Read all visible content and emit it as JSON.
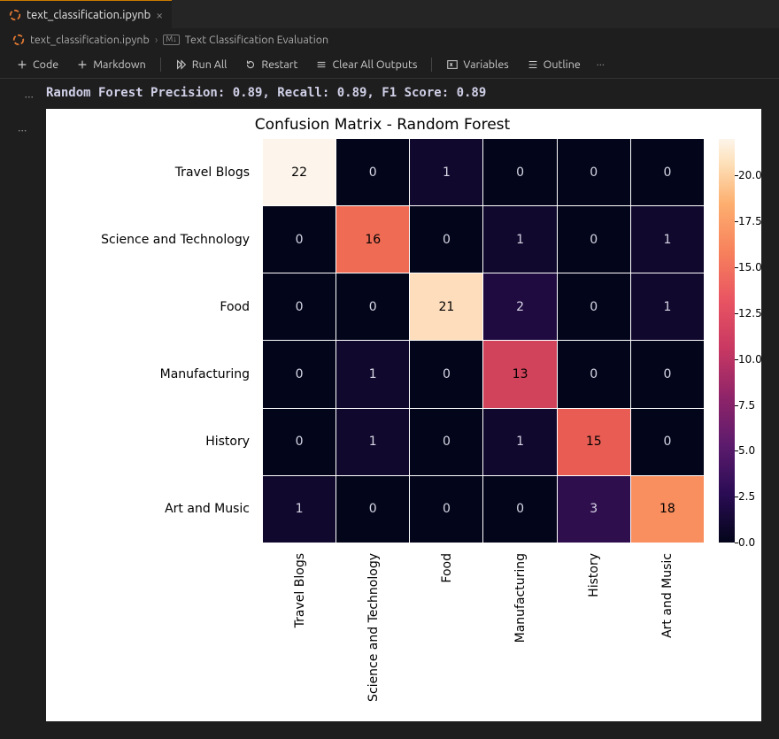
{
  "tab": {
    "filename": "text_classification.ipynb"
  },
  "breadcrumbs": {
    "file": "text_classification.ipynb",
    "cell": "Text Classification Evaluation"
  },
  "toolbar": {
    "code": "Code",
    "markdown": "Markdown",
    "run_all": "Run All",
    "restart": "Restart",
    "clear": "Clear All Outputs",
    "variables": "Variables",
    "outline": "Outline"
  },
  "output_text": "Random Forest Precision: 0.89, Recall: 0.89, F1 Score: 0.89",
  "chart_data": {
    "type": "heatmap",
    "title": "Confusion Matrix - Random Forest",
    "categories": [
      "Travel Blogs",
      "Science and Technology",
      "Food",
      "Manufacturing",
      "History",
      "Art and Music"
    ],
    "matrix": [
      [
        22,
        0,
        1,
        0,
        0,
        0
      ],
      [
        0,
        16,
        0,
        1,
        0,
        1
      ],
      [
        0,
        0,
        21,
        2,
        0,
        1
      ],
      [
        0,
        1,
        0,
        13,
        0,
        0
      ],
      [
        0,
        1,
        0,
        1,
        15,
        0
      ],
      [
        1,
        0,
        0,
        0,
        3,
        18
      ]
    ],
    "vmin": 0.0,
    "vmax": 22.0,
    "colorbar_ticks": [
      0.0,
      2.5,
      5.0,
      7.5,
      10.0,
      12.5,
      15.0,
      17.5,
      20.0
    ],
    "colormap": "rocket"
  }
}
